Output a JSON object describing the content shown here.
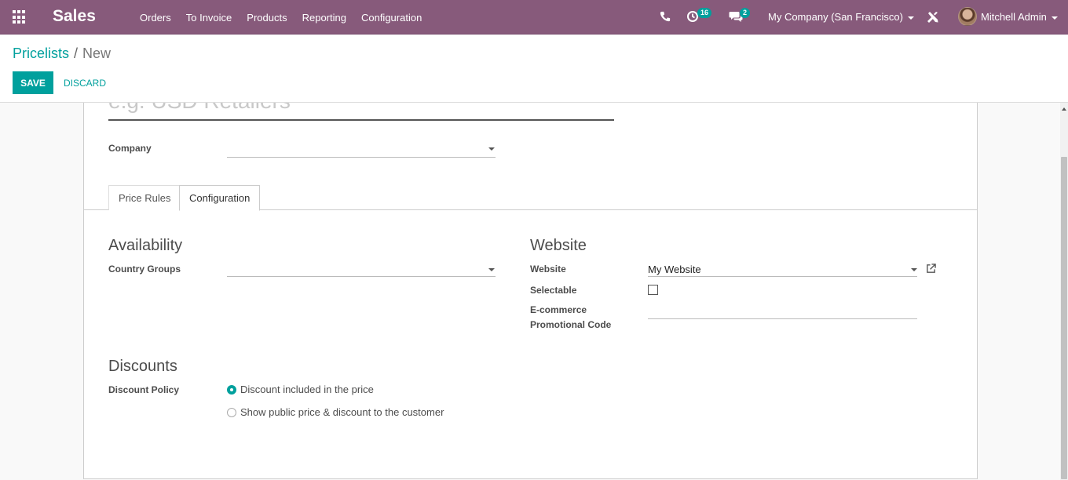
{
  "navbar": {
    "brand": "Sales",
    "menu": [
      "Orders",
      "To Invoice",
      "Products",
      "Reporting",
      "Configuration"
    ],
    "activity_count": "16",
    "message_count": "2",
    "company": "My Company (San Francisco)",
    "user": "Mitchell Admin",
    "accent": "#875a7b"
  },
  "breadcrumb": {
    "parent": "Pricelists",
    "separator": "/",
    "current": "New"
  },
  "buttons": {
    "save": "SAVE",
    "discard": "DISCARD",
    "primary_color": "#00a09d"
  },
  "form": {
    "name_placeholder": "e.g. USD Retailers",
    "company_label": "Company",
    "company_value": "",
    "tabs": [
      {
        "label": "Price Rules",
        "active": false
      },
      {
        "label": "Configuration",
        "active": true
      }
    ],
    "availability": {
      "title": "Availability",
      "country_groups_label": "Country Groups",
      "country_groups_value": ""
    },
    "website": {
      "title": "Website",
      "website_label": "Website",
      "website_value": "My Website",
      "selectable_label": "Selectable",
      "selectable_checked": false,
      "promo_label_line1": "E-commerce",
      "promo_label_line2": "Promotional Code",
      "promo_value": ""
    },
    "discounts": {
      "title": "Discounts",
      "policy_label": "Discount Policy",
      "options": [
        {
          "label": "Discount included in the price",
          "selected": true
        },
        {
          "label": "Show public price & discount to the customer",
          "selected": false
        }
      ]
    }
  }
}
